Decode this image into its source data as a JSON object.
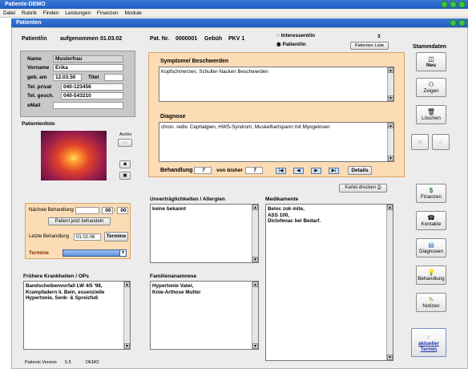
{
  "app": {
    "title": "Patiente-DEMO"
  },
  "menu": [
    "Datei",
    "Rubrik",
    "Finden",
    "Leistungen",
    "Finanzen",
    "Module"
  ],
  "window": {
    "title": "Patienten"
  },
  "header": {
    "patient_label": "Patient/in",
    "aufgenommen_label": "aufgenommen",
    "aufgenommen_value": "01.03.02",
    "pat_nr_label": "Pat. Nr.",
    "pat_nr_value": "0000001",
    "gebuehr_label": "Gebüh",
    "gebuehr_value": "PKV 1",
    "interessent_label": "Interessent/in",
    "interessent_count": "3",
    "patientin_label": "Patient/in",
    "patienten_liste": "Patienten Liste"
  },
  "person": {
    "name_label": "Name",
    "name_value": "Musterfrau",
    "vorname_label": "Vorname",
    "vorname_value": "Erika",
    "geb_label": "geb. am",
    "geb_value": "12.03.50",
    "titel_label": "Titel",
    "titel_value": "",
    "tel_privat_label": "Tel. privat",
    "tel_privat_value": "040-123456",
    "tel_gesch_label": "Tel. gesch.",
    "tel_gesch_value": "040-543210",
    "email_label": "eMail",
    "email_value": ""
  },
  "photo": {
    "label": "Patientenfoto",
    "archiv_label": "Archiv"
  },
  "symptome": {
    "label": "Symptome/ Beschwerden",
    "text": "Kopfschmerzen, Schulter-Nacken Beschwerden"
  },
  "diagnose": {
    "label": "Diagnose",
    "text": "chron. rediv. Cephalgien, HWS-Syndrom, Muskelhartspann mit Myogelosen"
  },
  "behandlung": {
    "label": "Behandlung",
    "value": "7",
    "von_bisher_label": "von bisher",
    "bisher_value": "7",
    "nav": [
      "|◀",
      "◀",
      "▶",
      "▶|"
    ],
    "details": "Details"
  },
  "kartei_drucken": "Kartei drucken",
  "termine_box": {
    "naechste_label": "Nächste Behandlung",
    "time_h": "00",
    "time_sep": ":",
    "time_m": "00",
    "jetzt_button": "Patient jetzt behandeln",
    "letzte_label": "Letzte Behandlung",
    "letzte_value": "01.02.06",
    "termine_button": "Termine",
    "termine_label": "Termine"
  },
  "unvertraeglichkeiten": {
    "label": "Unverträglichkeiten / Allergien",
    "text": "keine bekannt"
  },
  "medikamente": {
    "label": "Medikamente",
    "lines": [
      "Beloc zok mite,",
      "ASS 100,",
      "Diclofenac bei Bedarf."
    ]
  },
  "krankheiten": {
    "label": "Frühere Krankheiten / OPs",
    "lines": [
      "Bandscheibenvorfall LW 4/5 '98,",
      "Krampfadern li. Bein, essenzielle",
      "Hypertonie, Senk- & Spreizfuß"
    ]
  },
  "familie": {
    "label": "Familienanamnese",
    "lines": [
      "Hypertonie Vater,",
      "Knie-Arthose Mutter"
    ]
  },
  "stammdaten": {
    "label": "Stammdaten",
    "neu": "Neu",
    "zeigen": "Zeigen",
    "loeschen": "Löschen"
  },
  "side": {
    "finanzen": "Finanzen",
    "kontakte": "Kontakte",
    "diagnosen": "Diagnosen",
    "behandlung": "Behandlung",
    "notizen": "Notizen",
    "aktueller_termin_1": "aktueller",
    "aktueller_termin_2": "Termin"
  },
  "footer": {
    "version_label": "Patients Version",
    "version_value": "5.5",
    "build": "DEMO"
  },
  "colors": {
    "accent_orange": "#fbdcb4",
    "title_blue": "#1f5ec4",
    "link_blue": "#1a2fa8"
  }
}
